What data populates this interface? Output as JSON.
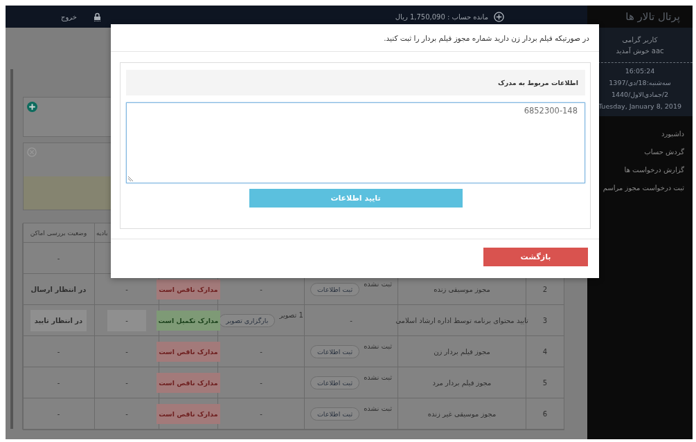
{
  "top_bar": {
    "balance": "مانده حساب : 1,750,090 ریال",
    "logout": "خروج"
  },
  "sidebar": {
    "title": "پرتال تالار ها",
    "greeting": [
      "کاربر گرامی",
      "aac خوش آمدید"
    ],
    "clock": [
      "16:05:24",
      "سه‌شنبه:18/دی/1397",
      "2/جمادی‌الاول/1440",
      "Tuesday, January 8, 2019"
    ],
    "items": [
      {
        "label": "داشبورد",
        "selected": false
      },
      {
        "label": "گردش حساب",
        "selected": false
      },
      {
        "label": "گزارش درخواست ها",
        "selected": false
      },
      {
        "label": "ثبت درخواست مجوز مراسم",
        "selected": false
      }
    ]
  },
  "table": {
    "columns": [
      "بادیه",
      "وضعیت بررسی اماکن"
    ],
    "rows": [
      {
        "column_6": "",
        "places": "-",
        "highlighted": false
      },
      {
        "number": "2",
        "title": "مجوز موسیقی زنده",
        "entry": {
          "text": "ثبت نشده",
          "button": "ثبت اطلاعات"
        },
        "image": {
          "text": "-"
        },
        "docs": {
          "text": "مدارک ناقص است",
          "kind": "incomplete"
        },
        "column_6": "-",
        "places": "در انتظار ارسال",
        "highlighted": false
      },
      {
        "number": "3",
        "title": "تایید محتوای برنامه توسط اداره ارشاد اسلامی",
        "entry": {
          "text": "-"
        },
        "image": {
          "text": "1 تصویر",
          "button": "بارگزاری تصویر"
        },
        "docs": {
          "text": "مدارک تکمیل است",
          "kind": "complete"
        },
        "column_6": "-",
        "places": "در انتظار تایید",
        "highlighted": true
      },
      {
        "number": "4",
        "title": "مجوز فیلم بردار زن",
        "entry": {
          "text": "ثبت نشده",
          "button": "ثبت اطلاعات"
        },
        "image": {
          "text": "-"
        },
        "docs": {
          "text": "مدارک ناقص است",
          "kind": "incomplete"
        },
        "column_6": "-",
        "places": "-",
        "highlighted": false
      },
      {
        "number": "5",
        "title": "مجوز فیلم بردار مرد",
        "entry": {
          "text": "ثبت نشده",
          "button": "ثبت اطلاعات"
        },
        "image": {
          "text": "-"
        },
        "docs": {
          "text": "مدارک ناقص است",
          "kind": "incomplete"
        },
        "column_6": "-",
        "places": "-",
        "highlighted": false
      },
      {
        "number": "6",
        "title": "مجوز موسیقی غیر زنده",
        "entry": {
          "text": "ثبت نشده",
          "button": "ثبت اطلاعات"
        },
        "image": {
          "text": "-"
        },
        "docs": {
          "text": "مدارک ناقص است",
          "kind": "incomplete"
        },
        "column_6": "-",
        "places": "-",
        "highlighted": false
      }
    ]
  },
  "modal": {
    "message": "در صورتیکه فیلم بردار زن دارید شماره مجوز فیلم بردار را ثبت کنید.",
    "section_label": "اطلاعات مربوط به مدرک",
    "value": "6852300-148",
    "submit": "تایید اطلاعات",
    "back": "بازگشت"
  }
}
